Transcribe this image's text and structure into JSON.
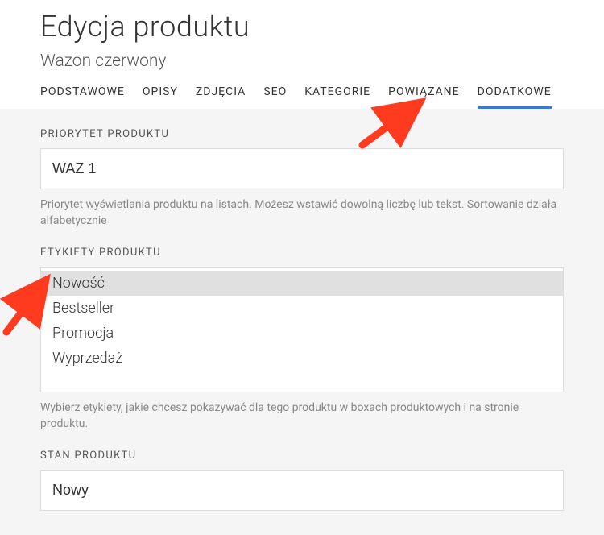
{
  "header": {
    "title": "Edycja produktu",
    "subtitle": "Wazon czerwony"
  },
  "tabs": [
    {
      "label": "PODSTAWOWE",
      "active": false
    },
    {
      "label": "OPISY",
      "active": false
    },
    {
      "label": "ZDJĘCIA",
      "active": false
    },
    {
      "label": "SEO",
      "active": false
    },
    {
      "label": "KATEGORIE",
      "active": false
    },
    {
      "label": "POWIĄZANE",
      "active": false
    },
    {
      "label": "DODATKOWE",
      "active": true
    }
  ],
  "priority": {
    "label": "PRIORYTET PRODUKTU",
    "value": "WAZ 1",
    "help": "Priorytet wyświetlania produktu na listach. Możesz wstawić dowolną liczbę lub tekst. Sortowanie działa alfabetycznie"
  },
  "labels": {
    "label": "ETYKIETY PRODUKTU",
    "options": [
      {
        "text": "Nowość",
        "selected": true
      },
      {
        "text": "Bestseller",
        "selected": false
      },
      {
        "text": "Promocja",
        "selected": false
      },
      {
        "text": "Wyprzedaż",
        "selected": false
      }
    ],
    "help": "Wybierz etykiety, jakie chcesz pokazywać dla tego produktu w boxach produktowych i na stronie produktu."
  },
  "condition": {
    "label": "STAN PRODUKTU",
    "value": "Nowy"
  }
}
